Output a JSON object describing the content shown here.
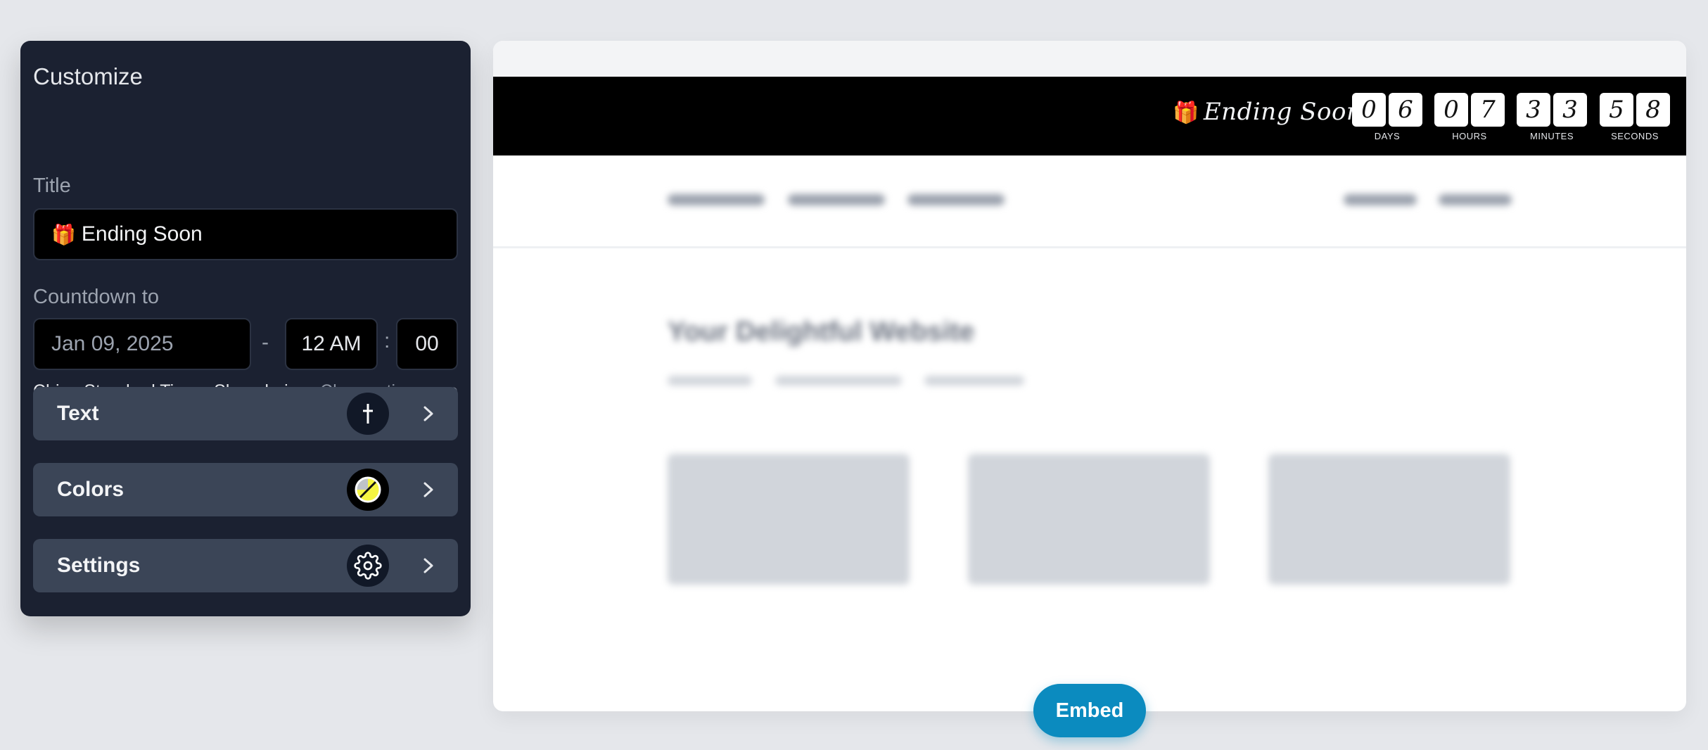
{
  "panel": {
    "heading": "Customize",
    "title_label": "Title",
    "title_icon": "🎁",
    "title_value": "Ending Soon",
    "countdown_label": "Countdown to",
    "date_value": "Jan 09, 2025",
    "dash": "-",
    "hour_value": "12 AM",
    "colon": ":",
    "minute_value": "00",
    "timezone": "China Standard Time - Shanghai",
    "change_timezone": "Change timezone",
    "rows": [
      {
        "label": "Text",
        "icon": "text-cursor-icon"
      },
      {
        "label": "Colors",
        "icon": "color-swatch-icon"
      },
      {
        "label": "Settings",
        "icon": "gear-icon"
      }
    ]
  },
  "preview": {
    "bar_icon": "🎁",
    "bar_title": "Ending Soon",
    "countdown": {
      "days": [
        "0",
        "6"
      ],
      "hours": [
        "0",
        "7"
      ],
      "minutes": [
        "3",
        "3"
      ],
      "seconds": [
        "5",
        "8"
      ],
      "labels": {
        "days": "DAYS",
        "hours": "HOURS",
        "minutes": "MINUTES",
        "seconds": "SECONDS"
      }
    },
    "hero_title": "Your Delightful Website"
  },
  "embed_label": "Embed",
  "colors": {
    "panel_bg": "#1b2131",
    "row_bg": "#3b4557",
    "bar_bg": "#000000",
    "accent": "#0b8bbf",
    "swatch_yellow": "#f5f542"
  }
}
